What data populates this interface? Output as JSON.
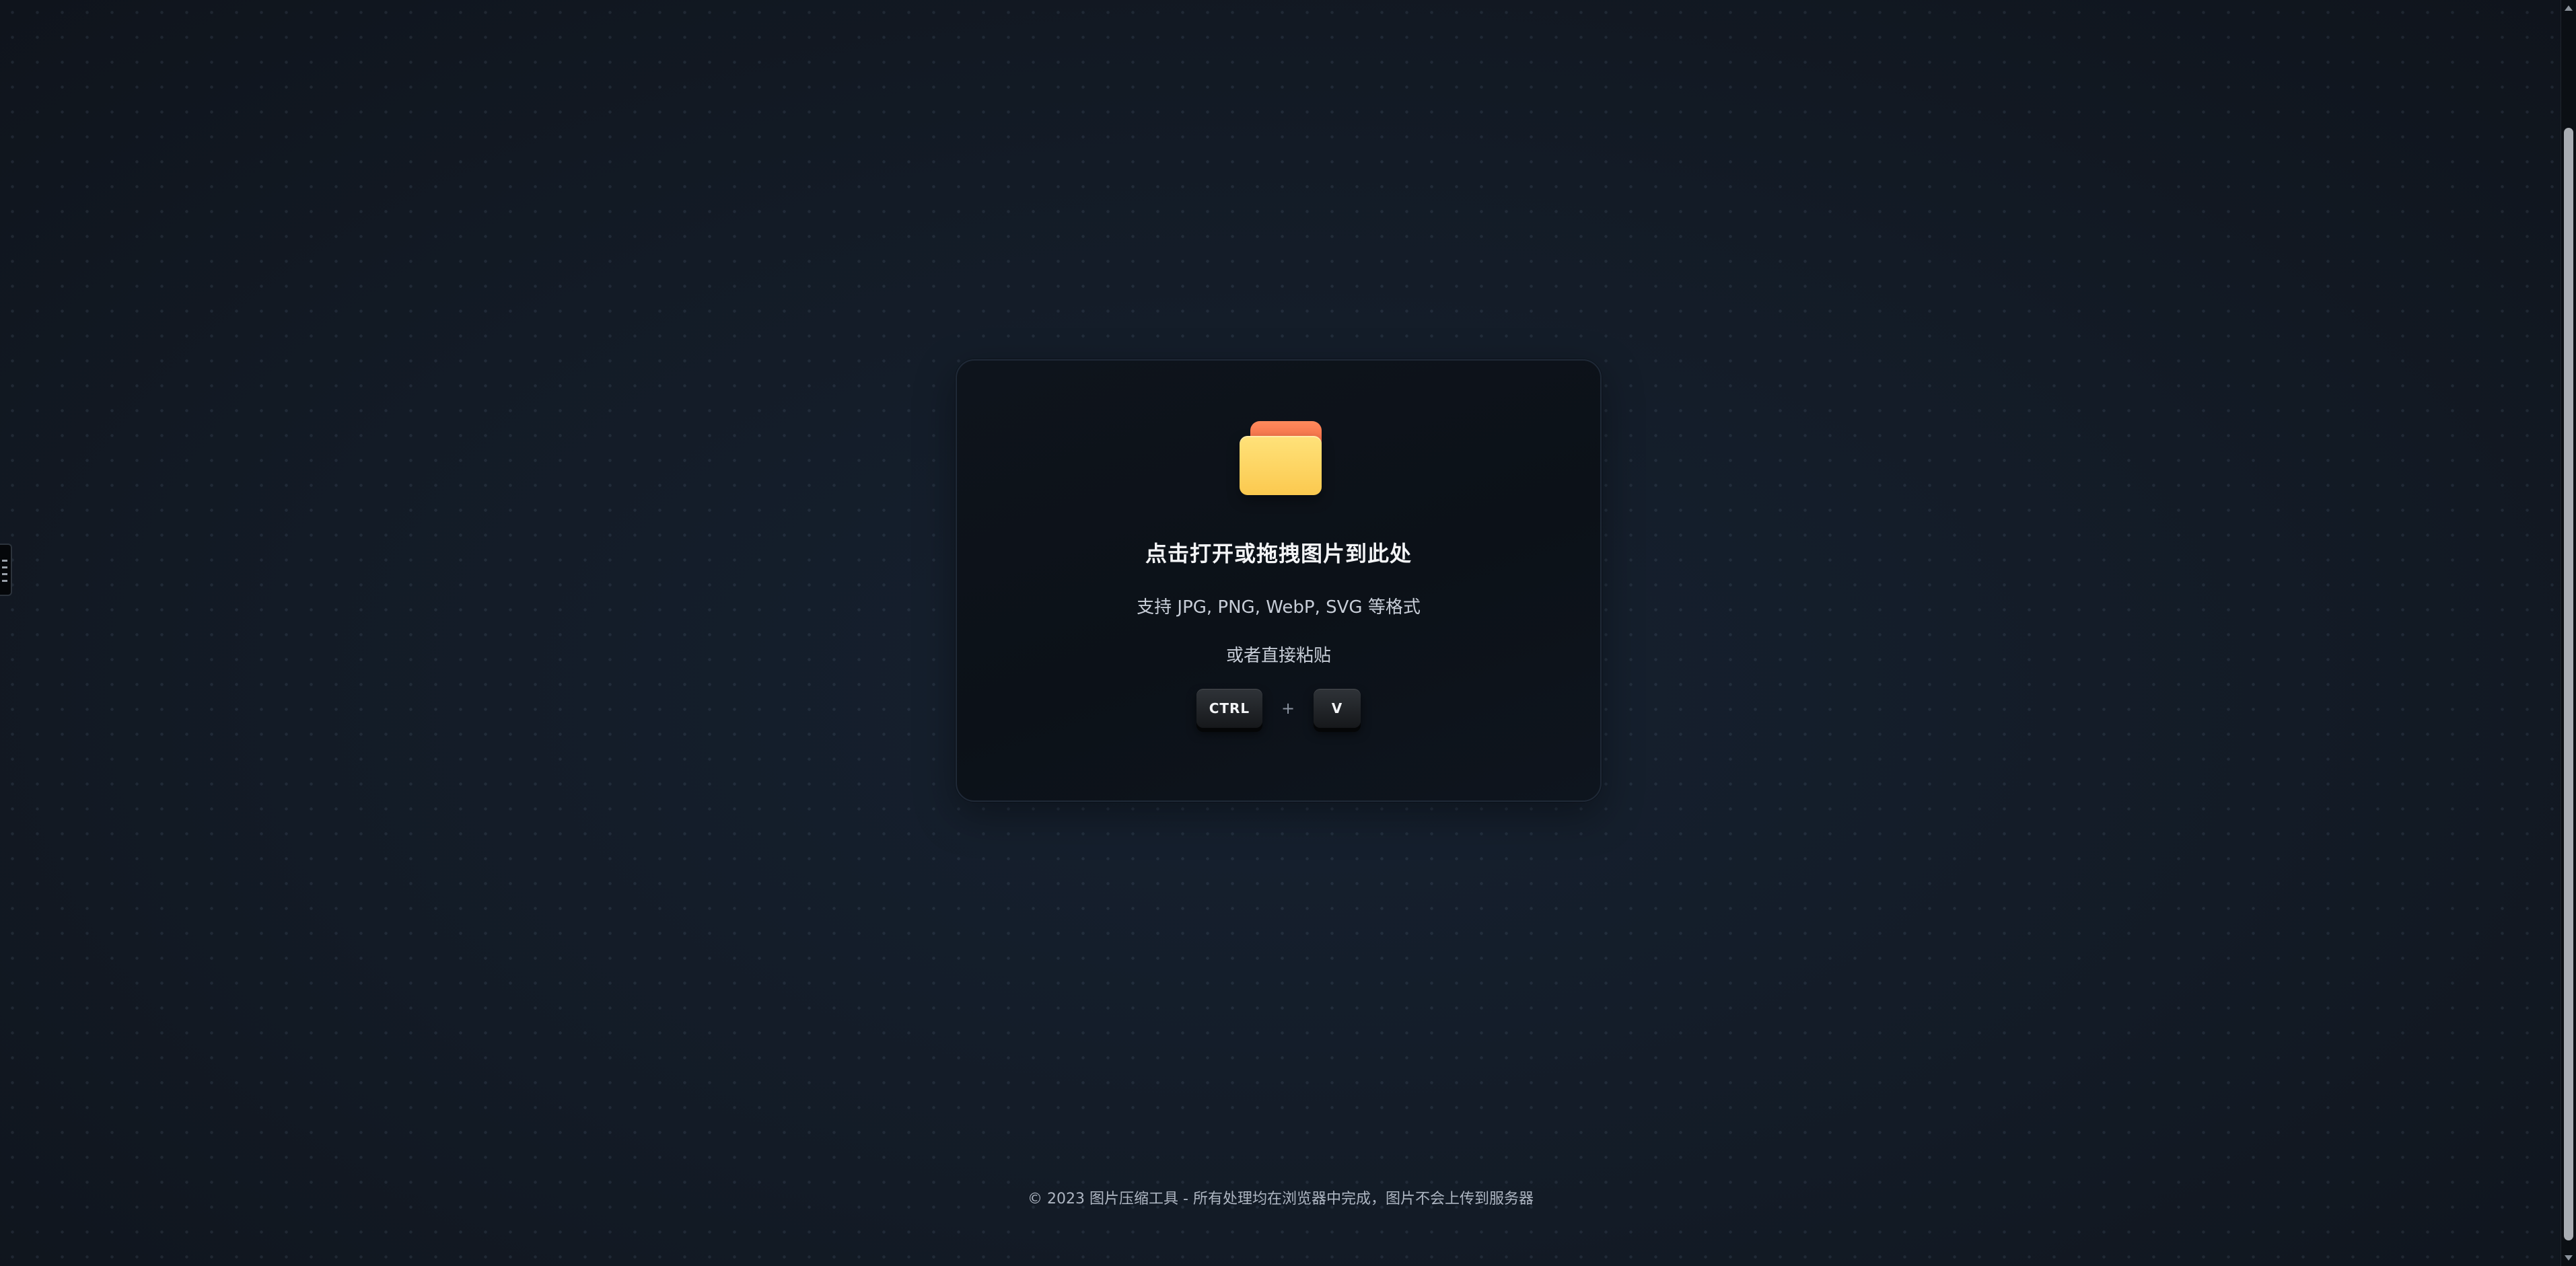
{
  "upload": {
    "title": "点击打开或拖拽图片到此处",
    "subtitle": "支持 JPG, PNG, WebP, SVG 等格式",
    "paste_hint": "或者直接粘贴",
    "shortcut": {
      "key1": "CTRL",
      "plus": "+",
      "key2": "V"
    }
  },
  "footer": {
    "text": "© 2023 图片压缩工具 - 所有处理均在浏览器中完成，图片不会上传到服务器"
  },
  "colors": {
    "background": "#131a24",
    "folder_tab": "#f0643f",
    "folder_body": "#fbc94f",
    "key": "#1e2125"
  },
  "icons": {
    "upload": "folder-icon"
  }
}
